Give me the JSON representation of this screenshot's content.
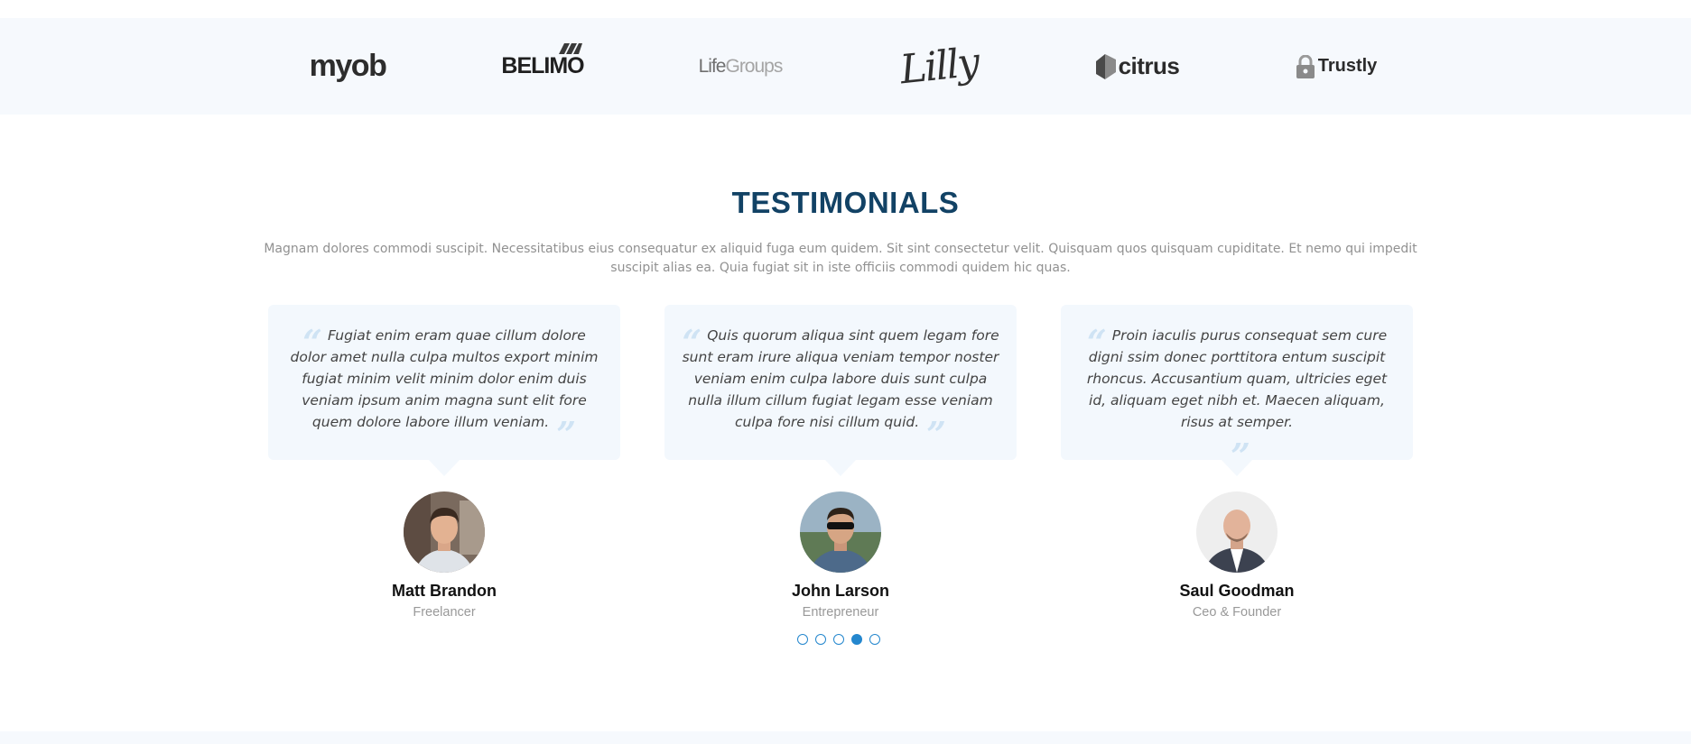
{
  "clients": {
    "logos": [
      {
        "name": "myob",
        "icon": "myob-logo"
      },
      {
        "name": "BELIMO",
        "icon": "belimo-logo"
      },
      {
        "name_part1": "Life",
        "name_part2": "Groups",
        "icon": "lifegroups-logo"
      },
      {
        "name": "Lilly",
        "icon": "lilly-logo"
      },
      {
        "name": "citrus",
        "icon": "citrus-logo"
      },
      {
        "name": "Trustly",
        "icon": "trustly-logo"
      }
    ]
  },
  "testimonials_section": {
    "title": "TESTIMONIALS",
    "description": "Magnam dolores commodi suscipit. Necessitatibus eius consequatur ex aliquid fuga eum quidem. Sit sint consectetur velit. Quisquam quos quisquam cupiditate. Et nemo qui impedit suscipit alias ea. Quia fugiat sit in iste officiis commodi quidem hic quas.",
    "items": [
      {
        "quote": "Fugiat enim eram quae cillum dolore dolor amet nulla culpa multos export minim fugiat minim velit minim dolor enim duis veniam ipsum anim magna sunt elit fore quem dolore labore illum veniam.",
        "name": "Matt Brandon",
        "role": "Freelancer"
      },
      {
        "quote": "Quis quorum aliqua sint quem legam fore sunt eram irure aliqua veniam tempor noster veniam enim culpa labore duis sunt culpa nulla illum cillum fugiat legam esse veniam culpa fore nisi cillum quid.",
        "name": "John Larson",
        "role": "Entrepreneur"
      },
      {
        "quote": "Proin iaculis purus consequat sem cure digni ssim donec porttitora entum suscipit rhoncus. Accusantium quam, ultricies eget id, aliquam eget nibh et. Maecen aliquam, risus at semper.",
        "name": "Saul Goodman",
        "role": "Ceo & Founder"
      }
    ],
    "pagination": {
      "total": 5,
      "active_index": 3
    }
  },
  "colors": {
    "accent": "#2487ce",
    "title": "#124265",
    "card_bg": "#f3f8fd",
    "strip_bg": "#f6f9fd"
  }
}
